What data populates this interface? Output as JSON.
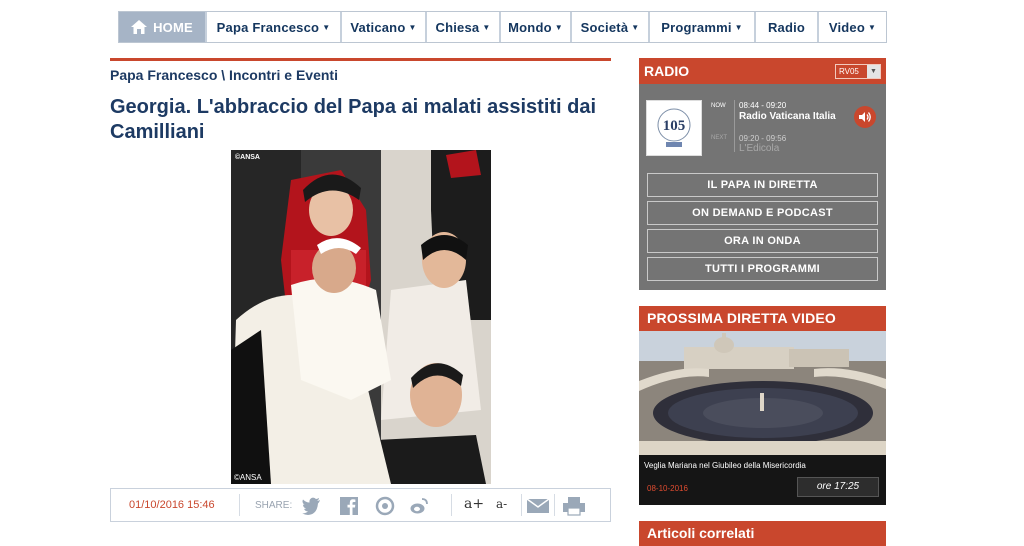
{
  "nav": {
    "home": "HOME",
    "items": [
      {
        "label": "Papa Francesco",
        "dropdown": true
      },
      {
        "label": "Vaticano",
        "dropdown": true
      },
      {
        "label": "Chiesa",
        "dropdown": true
      },
      {
        "label": "Mondo",
        "dropdown": true
      },
      {
        "label": "Società",
        "dropdown": true
      },
      {
        "label": "Programmi",
        "dropdown": true
      },
      {
        "label": "Radio",
        "dropdown": false
      },
      {
        "label": "Video",
        "dropdown": true
      }
    ]
  },
  "article": {
    "breadcrumb": "Papa Francesco \\ Incontri e Eventi",
    "title": "Georgia. L'abbraccio del Papa ai malati assistiti dai Camilliani",
    "photo_credit_top": "©ANSA",
    "photo_credit_bottom": "©ANSA"
  },
  "share": {
    "date": "01/10/2016 15:46",
    "label": "SHARE:",
    "font_plus": "a+",
    "font_minus": "a-",
    "icons": [
      "twitter-icon",
      "facebook-icon",
      "google-plus-icon",
      "weibo-icon",
      "email-icon",
      "print-icon"
    ]
  },
  "radio": {
    "title": "RADIO",
    "selector": "RV05",
    "logo_text": "105",
    "now_label": "NOW",
    "now_time": "08:44 - 09:20",
    "now_program": "Radio Vaticana Italia",
    "next_label": "NEXT",
    "next_time": "09:20 - 09:56",
    "next_program": "L'Edicola",
    "buttons": [
      "IL PAPA IN DIRETTA",
      "ON DEMAND E PODCAST",
      "ORA IN ONDA",
      "TUTTI I PROGRAMMI"
    ]
  },
  "video": {
    "title": "PROSSIMA DIRETTA VIDEO",
    "caption": "Veglia Mariana nel Giubileo della Misericordia",
    "date": "08-10-2016",
    "time": "ore 17:25"
  },
  "related": {
    "title": "Articoli correlati"
  },
  "colors": {
    "accent": "#c9472d",
    "navy": "#1d3a63",
    "radio_bg": "#747474"
  }
}
